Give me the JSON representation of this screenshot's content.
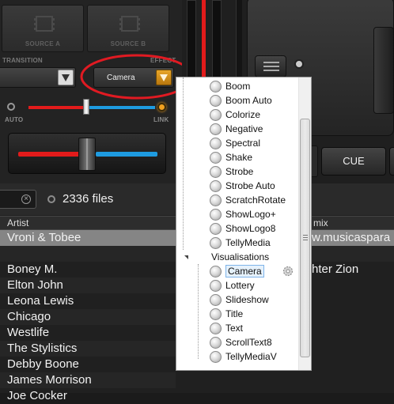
{
  "sources": {
    "a_label": "SOURCE A",
    "b_label": "SOURCE B"
  },
  "transition": {
    "label": "TRANSITION"
  },
  "effect": {
    "label": "EFFECT",
    "selected": "Camera"
  },
  "crossfader": {
    "auto_label": "AUTO",
    "link_label": "LINK"
  },
  "deck": {
    "cue_label": "CUE"
  },
  "browser": {
    "file_count": "2336 files",
    "columns": {
      "artist": "Artist",
      "remix": "mix"
    },
    "rows": [
      {
        "artist": "Vroni & Tobee",
        "remix": "w.musicaspara",
        "selected": true
      },
      {
        "artist": "",
        "remix": ""
      },
      {
        "artist": "Boney M.",
        "remix": "hter Zion"
      },
      {
        "artist": "Elton John",
        "remix": ""
      },
      {
        "artist": "Leona Lewis",
        "remix": ""
      },
      {
        "artist": "Chicago",
        "remix": ""
      },
      {
        "artist": "Westlife",
        "remix": ""
      },
      {
        "artist": "The Stylistics",
        "remix": ""
      },
      {
        "artist": "Debby Boone",
        "remix": ""
      },
      {
        "artist": "James Morrison",
        "remix": ""
      },
      {
        "artist": "Joe Cocker",
        "remix": ""
      }
    ]
  },
  "popup": {
    "effects": [
      "Boom",
      "Boom Auto",
      "Colorize",
      "Negative",
      "Spectral",
      "Shake",
      "Strobe",
      "Strobe Auto",
      "ScratchRotate",
      "ShowLogo+",
      "ShowLogo8",
      "TellyMedia"
    ],
    "group_label": "Visualisations",
    "visualisations": [
      "Camera",
      "Lottery",
      "Slideshow",
      "Title",
      "Text",
      "ScrollText8",
      "TellyMediaV"
    ],
    "selected": "Camera"
  },
  "colors": {
    "annotation_circle": "#e01a22",
    "crossfader_left": "#e21b1b",
    "crossfader_right": "#1e9be0",
    "effect_dropdown_arrow": "#d08d17",
    "link_led": "#f0a020"
  }
}
